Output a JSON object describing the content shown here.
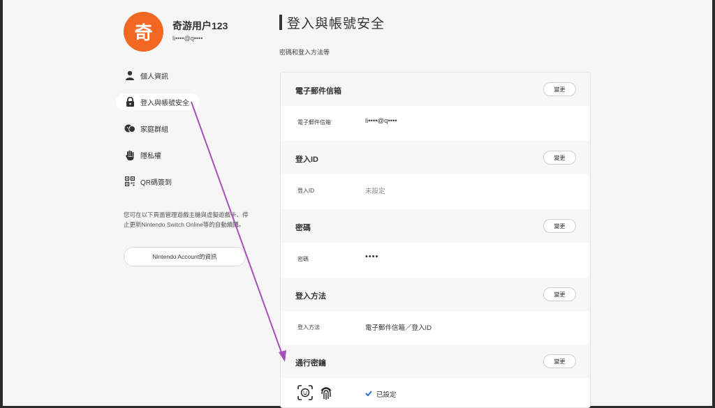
{
  "user": {
    "avatar_char": "奇",
    "name": "奇游用户123",
    "email": "li••••@q••••"
  },
  "sidebar": {
    "items": [
      {
        "label": "個人資訊",
        "icon": "person-icon"
      },
      {
        "label": "登入與帳號安全",
        "icon": "lock-icon",
        "active": true
      },
      {
        "label": "家庭群組",
        "icon": "family-icon"
      },
      {
        "label": "隱私權",
        "icon": "hand-icon"
      },
      {
        "label": "QR碼簽到",
        "icon": "qr-code-icon"
      }
    ],
    "note": "您可在以下頁面管理遊戲主機與虛擬遊戲卡、停止更新Nintendo Switch Online等的自動續購。",
    "account_button": "Nintendo Account的資訊"
  },
  "main": {
    "title": "登入與帳號安全",
    "subtitle": "密碼和登入方法等",
    "change_label": "變更",
    "sections": [
      {
        "title": "電子郵件信箱",
        "row_label": "電子郵件信箱",
        "row_value": "li••••@q••••"
      },
      {
        "title": "登入ID",
        "row_label": "登入ID",
        "row_value": "未設定"
      },
      {
        "title": "密碼",
        "row_label": "密碼",
        "row_value": "••••"
      },
      {
        "title": "登入方法",
        "row_label": "登入方法",
        "row_value": "電子郵件信箱／登入ID"
      },
      {
        "title": "通行密鑰",
        "status": "已設定"
      }
    ]
  },
  "colors": {
    "avatar": "#f26722",
    "annotation_arrow": "#a64fb8",
    "check": "#2d6fd6"
  }
}
